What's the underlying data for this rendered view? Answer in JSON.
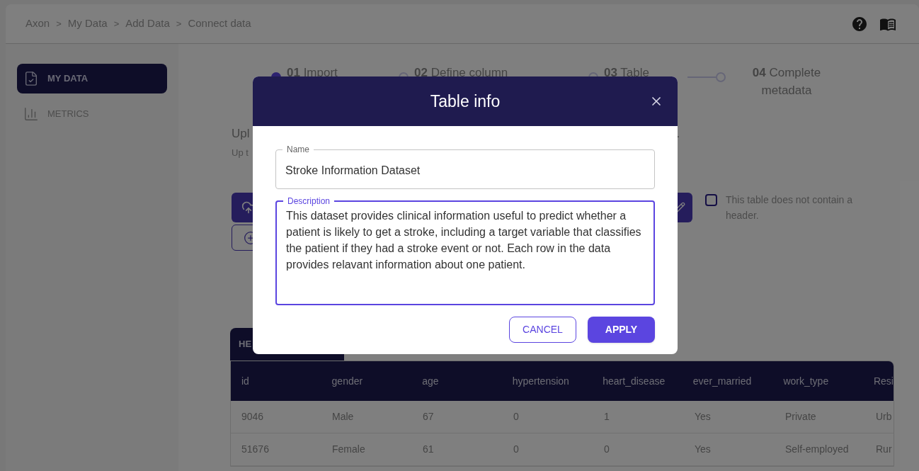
{
  "breadcrumb": [
    {
      "label": "Axon"
    },
    {
      "separator": ">",
      "label": "My Data"
    },
    {
      "separator": ">",
      "label": "Add Data"
    },
    {
      "separator": ">",
      "label": "Connect data"
    }
  ],
  "sidebar": {
    "items": [
      {
        "label": "MY DATA",
        "kind": "data",
        "selected": true
      },
      {
        "label": "METRICS",
        "kind": "metrics",
        "selected": false
      }
    ]
  },
  "steps": [
    {
      "label": "**01** Import",
      "current": true
    },
    {
      "label": "**02** Define column",
      "current": false
    },
    {
      "label": "**03** Table",
      "current": false
    },
    {
      "label": "**04** Complete metadata",
      "current": false
    }
  ],
  "upload": {
    "title": "Upl",
    "subtitle": "Up t",
    "title_end": "."
  },
  "header_checkbox": {
    "label": "This table does not contain a header.",
    "checked": false
  },
  "table_tab": {
    "label": "HE",
    "selected": true
  },
  "table": {
    "columns": [
      "id",
      "gender",
      "age",
      "hypertension",
      "heart_disease",
      "ever_married",
      "work_type",
      "Resi"
    ],
    "rows": [
      [
        "9046",
        "Male",
        "67",
        "0",
        "1",
        "Yes",
        "Private",
        "Urb"
      ],
      [
        "51676",
        "Female",
        "61",
        "0",
        "0",
        "Yes",
        "Self-employed",
        "Rur"
      ]
    ]
  },
  "dialog": {
    "title": "Table info",
    "name": {
      "label": "Name",
      "value": "Stroke Information Dataset",
      "focused": false
    },
    "description": {
      "label": "Description",
      "value": "This dataset provides clinical information useful to predict whether a patient is likely to get a stroke, including a target variable that classifies the patient if they had a stroke event or not. Each row in the data provides relavant information about one patient.",
      "focused": true
    },
    "buttons": [
      {
        "label": "CANCEL",
        "kind": "secondary"
      },
      {
        "label": "APPLY",
        "kind": "primary"
      }
    ]
  }
}
